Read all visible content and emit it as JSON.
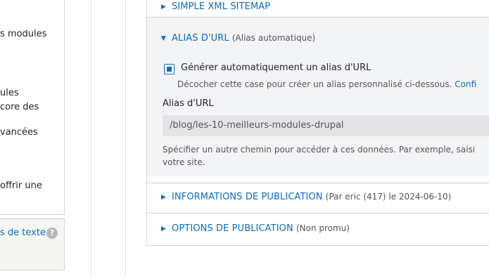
{
  "left_column": {
    "lines": [
      "s modules",
      "ules",
      "core des",
      "vancées",
      "offrir une"
    ],
    "footer_link": "s de texte",
    "help_icon": "?"
  },
  "accordion": {
    "items": [
      {
        "title": "SIMPLE XML SITEMAP",
        "subtitle": "",
        "expanded": false,
        "marker": "▶"
      },
      {
        "title": "ALIAS D'URL",
        "subtitle": "(Alias automatique)",
        "expanded": true,
        "marker": "▼"
      },
      {
        "title": "INFORMATIONS DE PUBLICATION",
        "subtitle": "(Par eric (417) le 2024-06-10)",
        "expanded": false,
        "marker": "▶"
      },
      {
        "title": "OPTIONS DE PUBLICATION",
        "subtitle": "(Non promu)",
        "expanded": false,
        "marker": "▶"
      }
    ],
    "alias_panel": {
      "checkbox_label": "Générer automatiquement un alias d'URL",
      "checkbox_checked": true,
      "checkbox_desc": "Décocher cette case pour créer un alias personnalisé ci-dessous.",
      "checkbox_desc_link": "Confi",
      "field_label": "Alias d'URL",
      "field_value": "/blog/les-10-meilleurs-modules-drupal",
      "field_desc_line1": "Spécifier un autre chemin pour accéder à ces données. Par exemple, saisi",
      "field_desc_line2": "votre site."
    }
  },
  "colors": {
    "accent": "#0a6dbe",
    "panel_bg": "#f3f4f5",
    "input_bg": "#e4e4e6",
    "border": "#d4d4d8"
  }
}
